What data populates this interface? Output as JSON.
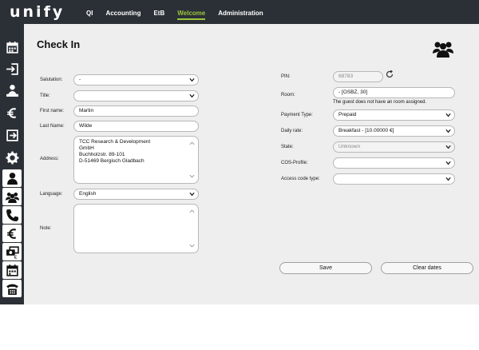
{
  "header": {
    "logo": "unify",
    "nav": [
      "QI",
      "Accounting",
      "EtB",
      "Welcome",
      "Administration"
    ],
    "active_nav": "Welcome"
  },
  "sidebar": {
    "icons": [
      "calendar-icon",
      "check-in-icon",
      "reception-person-icon",
      "euro-icon",
      "check-out-icon",
      "gear-icon",
      "person-icon",
      "group-icon",
      "phone-icon",
      "euro-icon",
      "money-icon",
      "calendar-icon",
      "phone-book-icon"
    ]
  },
  "page": {
    "title": "Check In"
  },
  "form_left": {
    "salutation": {
      "label": "Salutation:",
      "value": "-"
    },
    "title": {
      "label": "Title:",
      "value": ""
    },
    "first_name": {
      "label": "First name:",
      "value": "Martin"
    },
    "last_name": {
      "label": "Last Name:",
      "value": "Wilde"
    },
    "address": {
      "label": "Address:",
      "lines": [
        "TCC Research & Development",
        "GmbH",
        "Buchholzstr. 89-101",
        "D-51469 Bergisch Gladbach"
      ]
    },
    "language": {
      "label": "Language:",
      "value": "English"
    },
    "note": {
      "label": "Note:",
      "value": ""
    }
  },
  "form_right": {
    "pin": {
      "label": "PIN:",
      "value": "68783"
    },
    "room": {
      "label": "Room:",
      "value": "- [OSBZ, 30]",
      "note": "The guest does not have an room assigned."
    },
    "payment_type": {
      "label": "Payment Type:",
      "value": "Prepaid"
    },
    "daily_rate": {
      "label": "Daily rate:",
      "value": "Breakfast - [10.00000 €]"
    },
    "state": {
      "label": "State:",
      "value": "Unknown"
    },
    "cos_profile": {
      "label": "COS-Profile:",
      "value": ""
    },
    "access_code_type": {
      "label": "Access code type:",
      "value": ""
    }
  },
  "buttons": {
    "save": "Save",
    "clear_dates": "Clear dates"
  },
  "colors": {
    "dark": "#2b3036",
    "accent": "#9bc53d",
    "background": "#eeeeee"
  }
}
